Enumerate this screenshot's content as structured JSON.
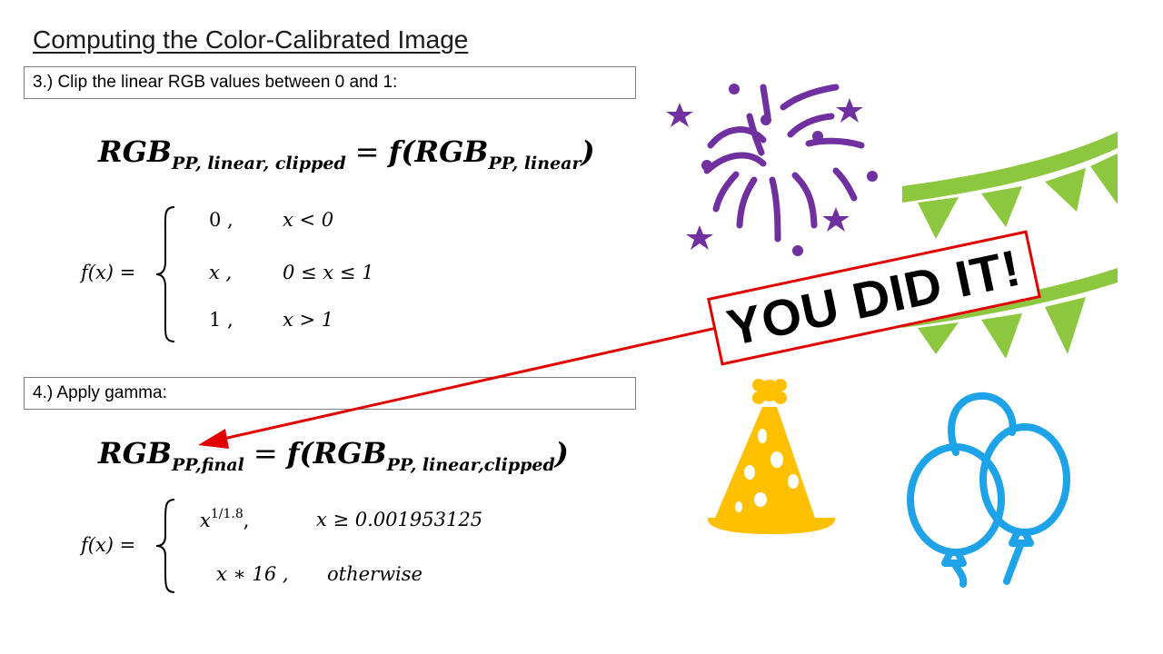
{
  "slide": {
    "title": "Computing the Color-Calibrated Image",
    "step3": {
      "label": "3.) Clip the linear RGB values between 0 and 1:",
      "eq_lhs": "RGB",
      "eq_lhs_sub": "PP, linear, clipped",
      "eq_sign": "=",
      "eq_rhs_f": "f(RGB",
      "eq_rhs_sub": "PP, linear",
      "eq_rhs_close": ")",
      "fx": "f(x) =",
      "cases": [
        {
          "value": "0 ,",
          "condition": "x < 0"
        },
        {
          "value": "x ,",
          "condition": "0 ≤ x ≤ 1"
        },
        {
          "value": "1 ,",
          "condition": "x > 1"
        }
      ]
    },
    "step4": {
      "label": "4.) Apply gamma:",
      "eq_lhs": "RGB",
      "eq_lhs_sub": "PP,final",
      "eq_sign": "=",
      "eq_rhs_f": "f(RGB",
      "eq_rhs_sub": "PP, linear,clipped",
      "eq_rhs_close": ")",
      "fx": "f(x) =",
      "case1_base": "x",
      "case1_exp": "1/1.8",
      "case1_comma": ",",
      "case1_condition": "x ≥ 0.001953125",
      "case2_value": "x ∗ 16 ,",
      "case2_condition": "otherwise"
    },
    "banner": {
      "text": "YOU DID IT!",
      "border_color": "#e00000"
    },
    "icons": {
      "fireworks": "fireworks-icon",
      "bunting": "bunting-icon",
      "party_hat": "party-hat-icon",
      "balloons": "balloons-icon"
    },
    "colors": {
      "fireworks": "#7030a0",
      "bunting": "#8dc63f",
      "party_hat": "#ffc000",
      "balloons": "#1fa3e8",
      "arrow": "#e00000"
    }
  }
}
